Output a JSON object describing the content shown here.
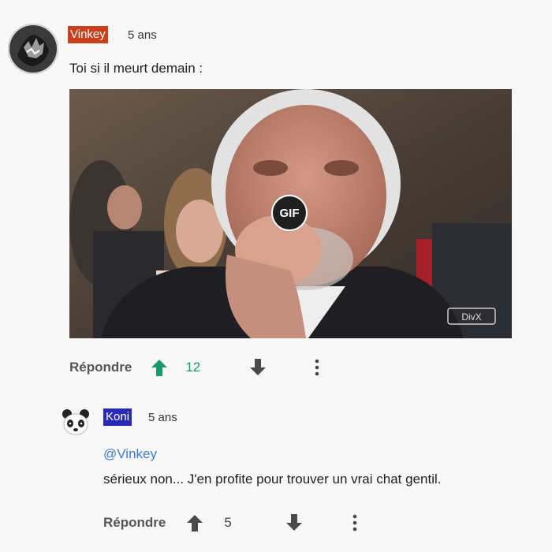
{
  "comment1": {
    "username": "Vinkey",
    "username_bg": "#c8401c",
    "time": "5 ans",
    "text": "Toi si il meurt demain :",
    "gif_label": "GIF",
    "reply_label": "Répondre",
    "upvotes": "12",
    "upvote_color": "#1a9a6a",
    "upvote_icon": "arrow-up-icon",
    "downvote_icon": "arrow-down-icon",
    "more_icon": "more-vertical-icon",
    "watermark": "DivX"
  },
  "comment2": {
    "username": "Koni",
    "username_bg": "#2a2ab8",
    "time": "5 ans",
    "mention": "@Vinkey",
    "text": "sérieux non... J'en profite pour trouver un vrai chat gentil.",
    "reply_label": "Répondre",
    "upvotes": "5",
    "upvote_icon": "arrow-up-icon",
    "downvote_icon": "arrow-down-icon",
    "more_icon": "more-vertical-icon"
  }
}
